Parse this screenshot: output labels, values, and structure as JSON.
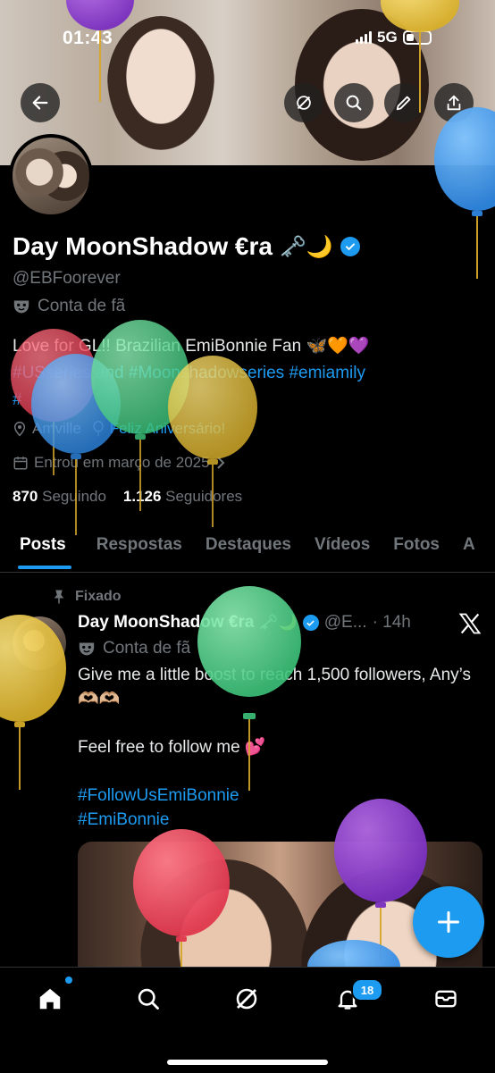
{
  "status_bar": {
    "time": "01:43",
    "network": "5G"
  },
  "profile": {
    "display_name": "Day MoonShadow €ra",
    "name_emoji": "🗝️🌙",
    "handle": "@EBFoorever",
    "fan_label": "Conta de fã",
    "bio_prefix": "Love for GL!! Brazilian EmiBonnie Fan ",
    "bio_emoji": "🦋🧡💜",
    "bio_hashtags": [
      "#USseries and #Moonshadowseries",
      "#emiamily",
      "#"
    ],
    "location": "Amville",
    "birthday": "Feliz Aniversário!",
    "joined": "Entrou em março de 2025",
    "following_count": "870",
    "following_label": "Seguindo",
    "followers_count": "1.126",
    "followers_label": "Seguidores"
  },
  "tabs": [
    {
      "label": "Posts"
    },
    {
      "label": "Respostas"
    },
    {
      "label": "Destaques"
    },
    {
      "label": "Vídeos"
    },
    {
      "label": "Fotos"
    },
    {
      "label": "A"
    }
  ],
  "pinned_post": {
    "pinned_label": "Fixado",
    "author_name": "Day MoonShadow €ra",
    "author_emoji": "🗝️🌙",
    "author_handle": "@E...",
    "time": "· 14h",
    "fan_label": "Conta de fã",
    "text": "Give me a little boost to reach 1,500 followers, Any’s 🫶🏼🫶🏼\n\nFeel free to follow me 💕",
    "hashtags": [
      "#FollowUsEmiBonnie",
      "#EmiBonnie"
    ]
  },
  "notifications_badge": "18",
  "colors": {
    "accent": "#1d9bf0",
    "text_primary": "#e7e9ea",
    "text_secondary": "#71767b",
    "background": "#000000"
  },
  "icons": [
    "back-arrow-icon",
    "grok-icon",
    "search-icon",
    "pencil-icon",
    "share-icon",
    "mask-icon",
    "location-icon",
    "balloon-icon",
    "calendar-icon",
    "chevron-right-icon",
    "pin-icon",
    "x-logo-icon",
    "plus-icon",
    "home-icon",
    "bell-icon",
    "mail-icon"
  ]
}
